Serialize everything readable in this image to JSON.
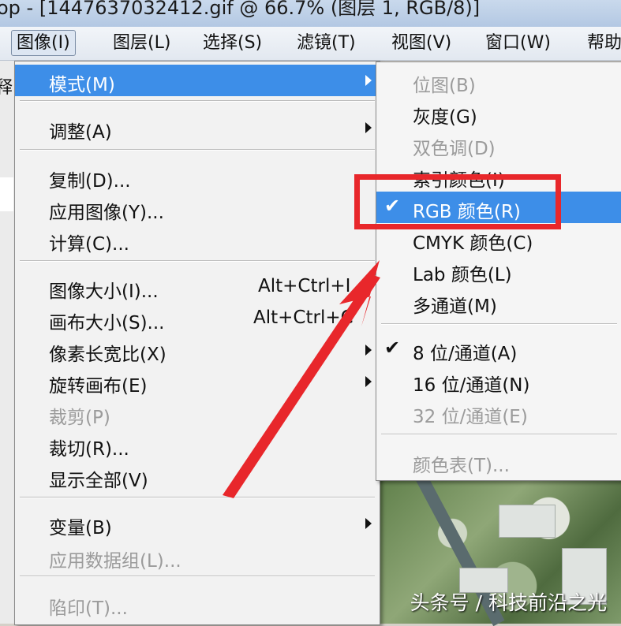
{
  "window": {
    "title_fragment": "op - [1447637032412.gif @ 66.7% (图层 1, RGB/8)]"
  },
  "menubar": [
    {
      "label": "图像(I)",
      "active": true
    },
    {
      "label": "图层(L)"
    },
    {
      "label": "选择(S)"
    },
    {
      "label": "滤镜(T)"
    },
    {
      "label": "视图(V)"
    },
    {
      "label": "窗口(W)"
    },
    {
      "label": "帮助"
    }
  ],
  "left_panel_glyph": "释",
  "image_menu": {
    "items": [
      {
        "label": "模式(M)",
        "submenu": true,
        "highlighted": true
      },
      {
        "label": "调整(A)",
        "submenu": true
      },
      {
        "label": "复制(D)..."
      },
      {
        "label": "应用图像(Y)..."
      },
      {
        "label": "计算(C)..."
      },
      {
        "label": "图像大小(I)...",
        "shortcut": "Alt+Ctrl+I"
      },
      {
        "label": "画布大小(S)...",
        "shortcut": "Alt+Ctrl+C"
      },
      {
        "label": "像素长宽比(X)",
        "submenu": true
      },
      {
        "label": "旋转画布(E)",
        "submenu": true
      },
      {
        "label": "裁剪(P)",
        "disabled": true
      },
      {
        "label": "裁切(R)..."
      },
      {
        "label": "显示全部(V)"
      },
      {
        "label": "变量(B)",
        "submenu": true
      },
      {
        "label": "应用数据组(L)...",
        "disabled": true
      },
      {
        "label": "陷印(T)...",
        "disabled": true
      }
    ]
  },
  "mode_submenu": {
    "items": [
      {
        "label": "位图(B)",
        "disabled": true
      },
      {
        "label": "灰度(G)"
      },
      {
        "label": "双色调(D)",
        "disabled": true
      },
      {
        "label": "索引颜色(I)"
      },
      {
        "label": "RGB 颜色(R)",
        "checked": true,
        "highlighted": true
      },
      {
        "label": "CMYK 颜色(C)"
      },
      {
        "label": "Lab 颜色(L)"
      },
      {
        "label": "多通道(M)"
      },
      {
        "label": "8 位/通道(A)",
        "checked": true
      },
      {
        "label": "16 位/通道(N)"
      },
      {
        "label": "32 位/通道(E)",
        "disabled": true
      },
      {
        "label": "颜色表(T)...",
        "disabled": true
      }
    ]
  },
  "check_glyph": "✔",
  "watermark": "头条号 / 科技前沿之光",
  "colors": {
    "highlight": "#3d8ee8",
    "annotation_red": "#e8272b",
    "disabled_text": "#9b9b9b"
  }
}
